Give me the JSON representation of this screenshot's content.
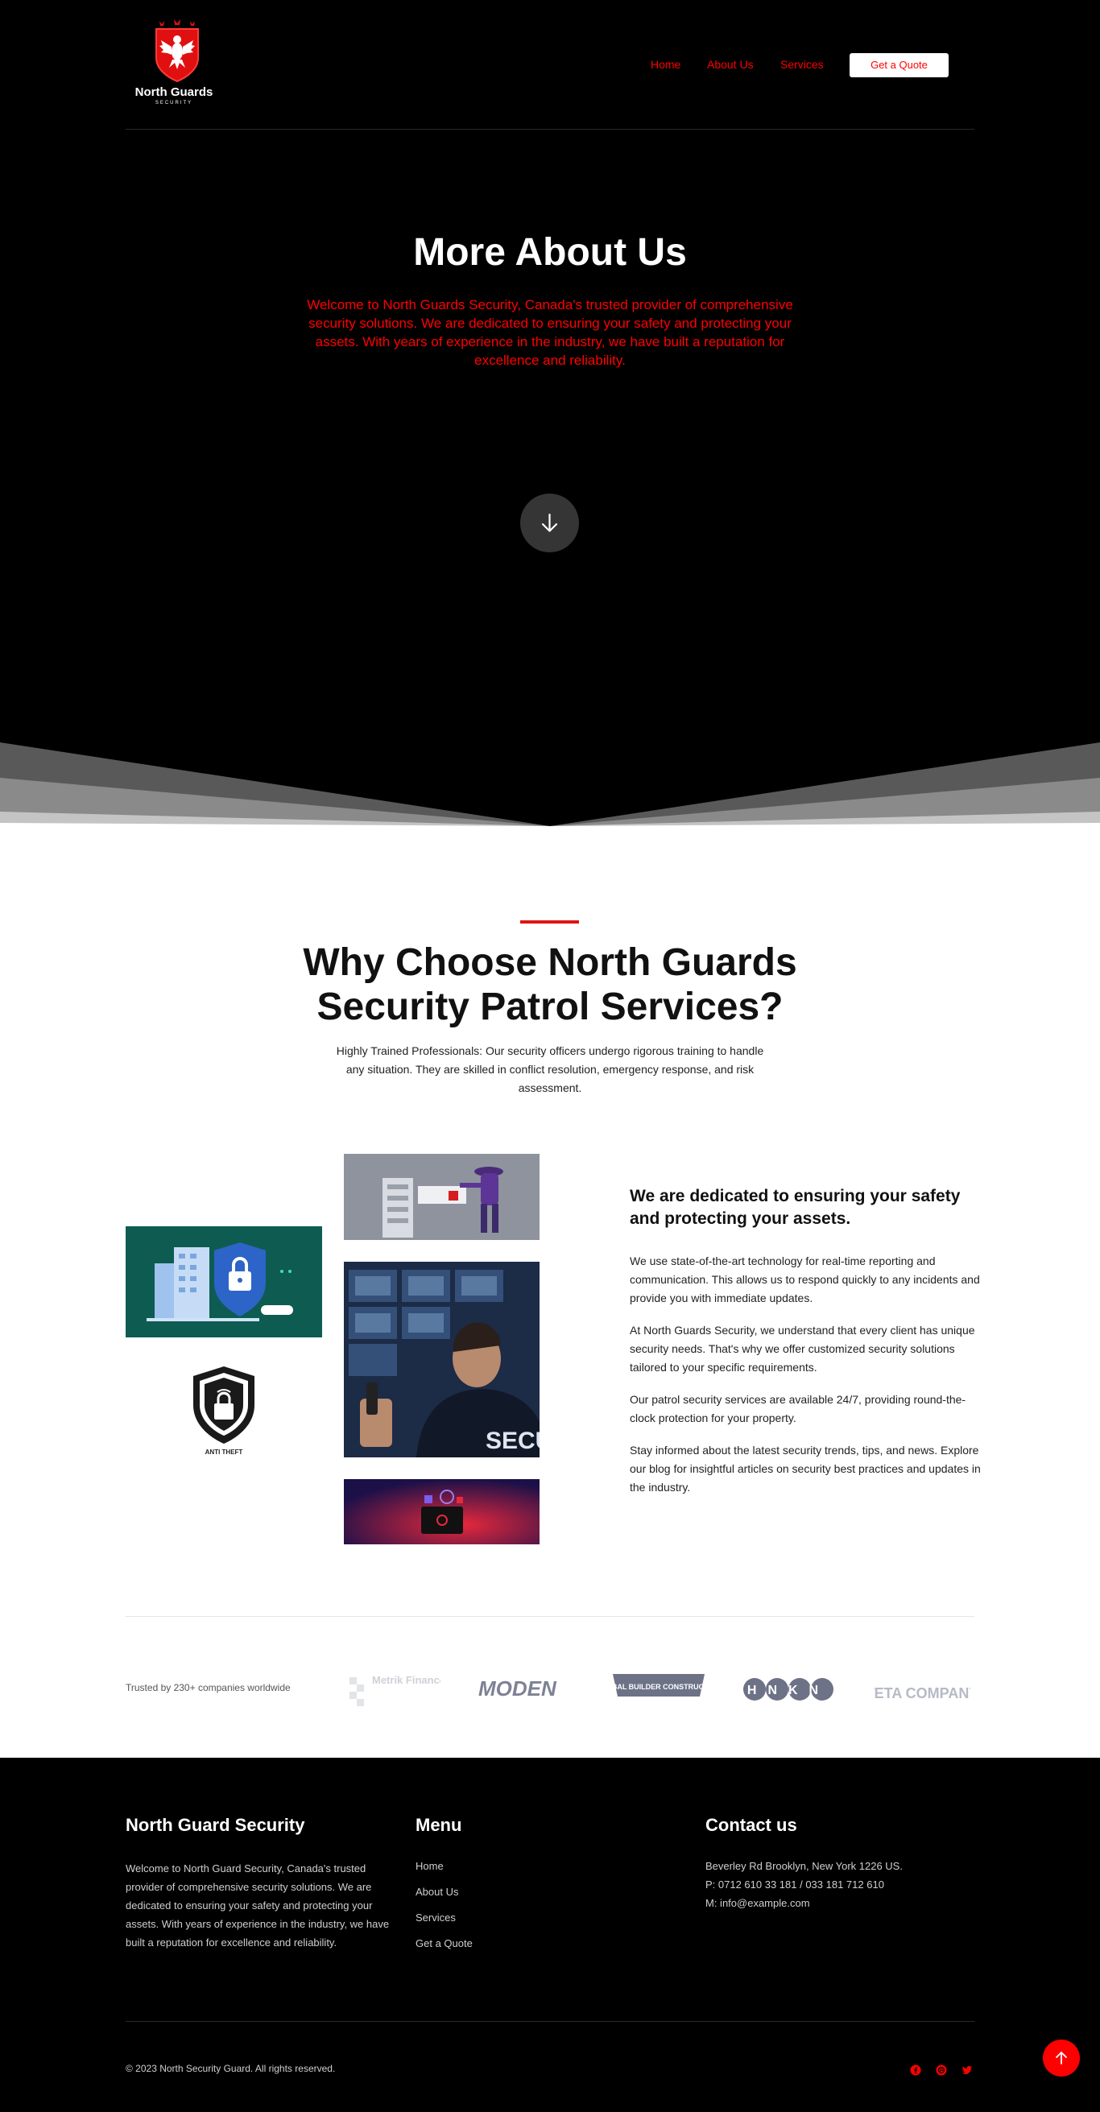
{
  "brand": {
    "name": "North Guards",
    "tagline": "SECURITY"
  },
  "nav": {
    "home": "Home",
    "about": "About Us",
    "services": "Services",
    "quote": "Get a Quote"
  },
  "hero": {
    "title": "More About Us",
    "text": "Welcome to North Guards Security, Canada's trusted provider of comprehensive security solutions. We are dedicated to ensuring your safety and protecting your assets. With years of experience in the industry, we have built a reputation for excellence and reliability.",
    "scroll_icon": "arrow-down-icon"
  },
  "why": {
    "title": "Why Choose North Guards Security Patrol Services?",
    "intro": "Highly Trained Professionals: Our security officers undergo rigorous training to handle any situation. They are skilled in conflict resolution, emergency response, and risk assessment.",
    "anti_theft_label": "ANTI THEFT",
    "subtitle": "We are dedicated to ensuring your safety and protecting your assets.",
    "paragraphs": [
      "We use state-of-the-art technology for real-time reporting and communication. This allows us to respond quickly to any incidents and provide you with immediate updates.",
      "At North Guards Security, we understand that every client has unique security needs. That's why we offer customized security solutions tailored to your specific requirements.",
      "Our patrol security services are available 24/7, providing round-the-clock protection for your property.",
      "Stay informed about the latest security trends, tips, and news. Explore our blog for insightful articles on security best practices and updates in the industry."
    ]
  },
  "trusted": {
    "label": "Trusted by 230+ companies worldwide",
    "partners": [
      "Metrik Finance Services.",
      "MODEN",
      "GLOBAL BUILDER CONSTRUCTION",
      "HNKN",
      "TETA COMPANY"
    ]
  },
  "footer": {
    "about_title": "North Guard Security",
    "about_text": "Welcome to North Guard Security, Canada's trusted provider of comprehensive security solutions. We are dedicated to ensuring your safety and protecting your assets. With years of experience in the industry, we have built a reputation for excellence and reliability.",
    "menu_title": "Menu",
    "menu": [
      "Home",
      "About Us",
      "Services",
      "Get a Quote"
    ],
    "contact_title": "Contact us",
    "contact": [
      "Beverley Rd Brooklyn, New York 1226 US.",
      "P: 0712 610 33 181 / 033 181 712 610",
      "M: info@example.com"
    ],
    "copyright": "© 2023 North Security Guard. All rights reserved.",
    "socials": [
      "facebook-icon",
      "dribbble-icon",
      "twitter-icon"
    ]
  },
  "colors": {
    "accent": "#ff0000",
    "background": "#000000",
    "section_bg": "#ffffff"
  }
}
